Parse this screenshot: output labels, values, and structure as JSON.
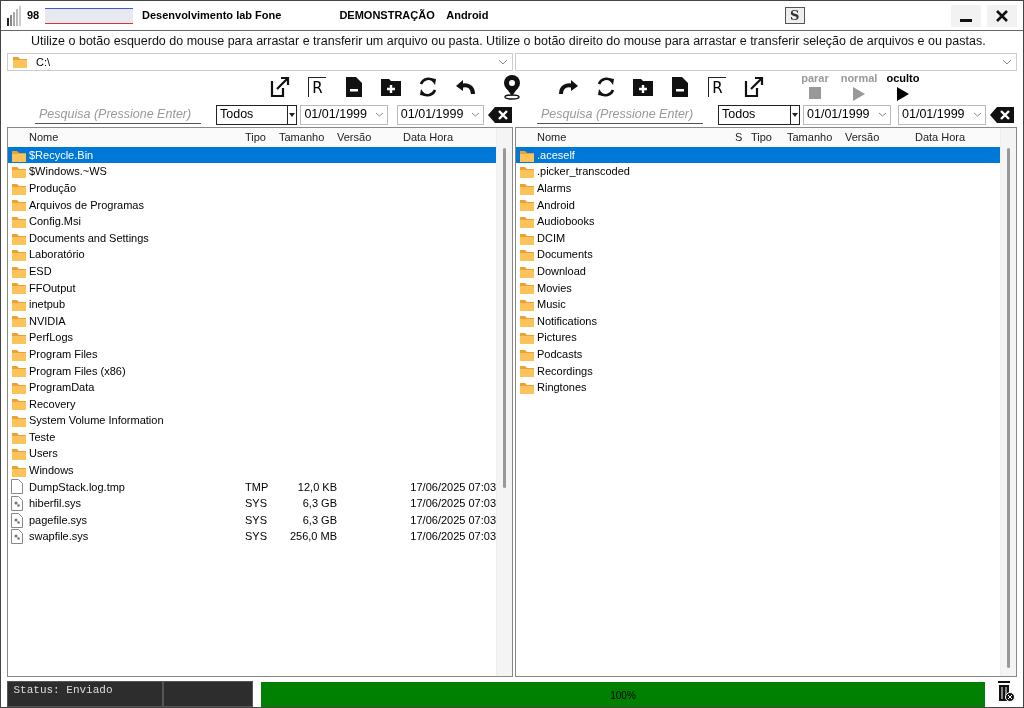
{
  "title_bar": {
    "signal_text": "98",
    "title": "Desenvolvimento lab Fone",
    "mode": "DEMONSTRAÇÃO",
    "device": "Android",
    "center_icon_letter": "S"
  },
  "hint": "Utilize o botão esquerdo do mouse para arrastar e transferir um arquivo ou pasta. Utilize o botão direito do mouse para arrastar e transferir seleção de arquivos e ou pastas.",
  "left_path": "C:\\",
  "left_tools": [
    {
      "kind": "export"
    },
    {
      "kind": "letter",
      "label": "R"
    },
    {
      "kind": "file-minus"
    },
    {
      "kind": "folder-plus"
    },
    {
      "kind": "refresh"
    },
    {
      "kind": "undo"
    }
  ],
  "right_tools": [
    {
      "kind": "redo"
    },
    {
      "kind": "refresh"
    },
    {
      "kind": "folder-plus"
    },
    {
      "kind": "file-minus"
    },
    {
      "kind": "letter",
      "label": "R"
    },
    {
      "kind": "export"
    }
  ],
  "playback": [
    {
      "label": "parar",
      "kind": "stop",
      "selected": false
    },
    {
      "label": "normal",
      "kind": "play",
      "selected": false
    },
    {
      "label": "oculto",
      "kind": "play",
      "selected": true
    }
  ],
  "left_panel": {
    "search": {
      "placeholder": "Pesquisa (Pressione Enter)"
    },
    "filter": "Todos",
    "date_from": "01/01/1999",
    "date_to": "01/01/1999",
    "columns": [
      "Nome",
      "Tipo",
      "Tamanho",
      "Versão",
      "Data Hora"
    ],
    "rows": [
      {
        "name": "$Recycle.Bin",
        "kind": "folder",
        "selected": true
      },
      {
        "name": "$Windows.~WS",
        "kind": "folder",
        "selected": false
      },
      {
        "name": "Produção",
        "kind": "folder",
        "selected": false
      },
      {
        "name": "Arquivos de Programas",
        "kind": "folder",
        "selected": false
      },
      {
        "name": "Config.Msi",
        "kind": "folder",
        "selected": false
      },
      {
        "name": "Documents and Settings",
        "kind": "folder",
        "selected": false
      },
      {
        "name": "Laboratório",
        "kind": "folder",
        "selected": false
      },
      {
        "name": "ESD",
        "kind": "folder",
        "selected": false
      },
      {
        "name": "FFOutput",
        "kind": "folder",
        "selected": false
      },
      {
        "name": "inetpub",
        "kind": "folder",
        "selected": false
      },
      {
        "name": "NVIDIA",
        "kind": "folder",
        "selected": false
      },
      {
        "name": "PerfLogs",
        "kind": "folder",
        "selected": false
      },
      {
        "name": "Program Files",
        "kind": "folder",
        "selected": false
      },
      {
        "name": "Program Files (x86)",
        "kind": "folder",
        "selected": false
      },
      {
        "name": "ProgramData",
        "kind": "folder",
        "selected": false
      },
      {
        "name": "Recovery",
        "kind": "folder",
        "selected": false
      },
      {
        "name": "System Volume Information",
        "kind": "folder",
        "selected": false
      },
      {
        "name": "Teste",
        "kind": "folder",
        "selected": false
      },
      {
        "name": "Users",
        "kind": "folder",
        "selected": false
      },
      {
        "name": "Windows",
        "kind": "folder",
        "selected": false
      },
      {
        "name": "DumpStack.log.tmp",
        "kind": "file",
        "type": "TMP",
        "size": "12,0 KB",
        "datetime": "17/06/2025 07:03",
        "selected": false
      },
      {
        "name": "hiberfil.sys",
        "kind": "system-file",
        "type": "SYS",
        "size": "6,3 GB",
        "datetime": "17/06/2025 07:03",
        "selected": false
      },
      {
        "name": "pagefile.sys",
        "kind": "system-file",
        "type": "SYS",
        "size": "6,3 GB",
        "datetime": "17/06/2025 07:03",
        "selected": false
      },
      {
        "name": "swapfile.sys",
        "kind": "system-file",
        "type": "SYS",
        "size": "256,0 MB",
        "datetime": "17/06/2025 07:03",
        "selected": false
      }
    ]
  },
  "right_panel": {
    "search": {
      "placeholder": "Pesquisa (Pressione Enter)"
    },
    "filter": "Todos",
    "date_from": "01/01/1999",
    "date_to": "01/01/1999",
    "columns": [
      "Nome",
      "S",
      "Tipo",
      "Tamanho",
      "Versão",
      "Data Hora"
    ],
    "rows": [
      {
        "name": ".aceself",
        "kind": "folder",
        "selected": true
      },
      {
        "name": ".picker_transcoded",
        "kind": "folder",
        "selected": false
      },
      {
        "name": "Alarms",
        "kind": "folder",
        "selected": false
      },
      {
        "name": "Android",
        "kind": "folder",
        "selected": false
      },
      {
        "name": "Audiobooks",
        "kind": "folder",
        "selected": false
      },
      {
        "name": "DCIM",
        "kind": "folder",
        "selected": false
      },
      {
        "name": "Documents",
        "kind": "folder",
        "selected": false
      },
      {
        "name": "Download",
        "kind": "folder",
        "selected": false
      },
      {
        "name": "Movies",
        "kind": "folder",
        "selected": false
      },
      {
        "name": "Music",
        "kind": "folder",
        "selected": false
      },
      {
        "name": "Notifications",
        "kind": "folder",
        "selected": false
      },
      {
        "name": "Pictures",
        "kind": "folder",
        "selected": false
      },
      {
        "name": "Podcasts",
        "kind": "folder",
        "selected": false
      },
      {
        "name": "Recordings",
        "kind": "folder",
        "selected": false
      },
      {
        "name": "Ringtones",
        "kind": "folder",
        "selected": false
      }
    ]
  },
  "status_bar": {
    "text": "Status: Enviado",
    "level": 1,
    "reading": "100%"
  }
}
